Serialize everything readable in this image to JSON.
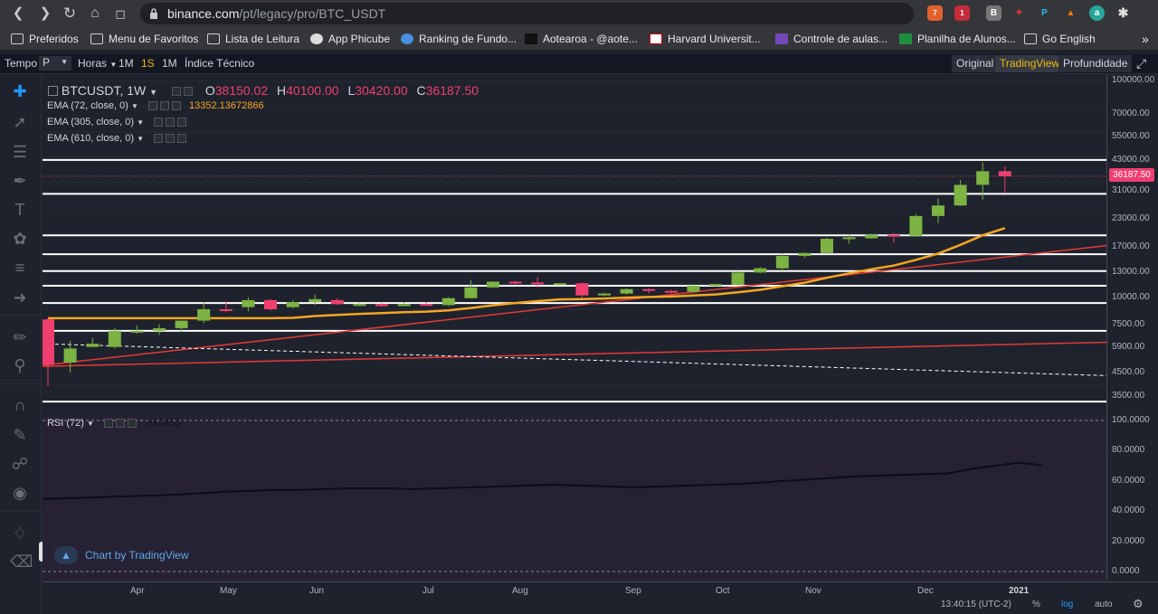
{
  "browser": {
    "url_domain": "binance.com",
    "url_path": "/pt/legacy/pro/BTC_USDT",
    "ext_badge_1": "7",
    "ext_badge_2": "1",
    "bookmarks": [
      {
        "label": "Preferidos",
        "icon": "folder-icon"
      },
      {
        "label": "Menu de Favoritos",
        "icon": "folder-icon"
      },
      {
        "label": "Lista de Leitura",
        "icon": "folder-icon"
      },
      {
        "label": "App Phicube",
        "icon": "globe-icon"
      },
      {
        "label": "Ranking de Fundo...",
        "icon": "page-icon"
      },
      {
        "label": "Aotearoa - @aote...",
        "icon": "page-icon"
      },
      {
        "label": "Harvard Universit...",
        "icon": "page-icon"
      },
      {
        "label": "Controle de aulas...",
        "icon": "form-icon"
      },
      {
        "label": "Planilha de Alunos...",
        "icon": "sheet-icon"
      },
      {
        "label": "Go English",
        "icon": "folder-icon"
      }
    ]
  },
  "toolbar": {
    "tempo": "Tempo",
    "interval": "P",
    "horas": "Horas",
    "m1a": "1M",
    "s1": "1S",
    "m1b": "1M",
    "indicator": "Índice Técnico",
    "view_original": "Original",
    "view_tradingview": "TradingView",
    "view_depth": "Profundidade"
  },
  "legend": {
    "symbol": "BTCUSDT, 1W",
    "o_label": "O",
    "o_value": "38150.02",
    "h_label": "H",
    "h_value": "40100.00",
    "l_label": "L",
    "l_value": "30420.00",
    "c_label": "C",
    "c_value": "36187.50",
    "ema1": "EMA (72, close, 0)",
    "ema1_value": "13352.13672866",
    "ema2": "EMA (305, close, 0)",
    "ema3": "EMA (610, close, 0)",
    "rsi": "RSI (72)",
    "rsi_value": "70.2451",
    "watermark": "Chart by TradingView"
  },
  "price_axis": [
    "100000.00",
    "70000.00",
    "55000.00",
    "43000.00",
    "31000.00",
    "23000.00",
    "17000.00",
    "13000.00",
    "10000.00",
    "7500.00",
    "5900.00",
    "4500.00",
    "3500.00"
  ],
  "last_price": "36187.50",
  "rsi_axis": [
    "100.0000",
    "80.0000",
    "60.0000",
    "40.0000",
    "20.0000",
    "0.0000"
  ],
  "time_axis": [
    "Apr",
    "May",
    "Jun",
    "Jul",
    "Aug",
    "Sep",
    "Oct",
    "Nov",
    "Dec",
    "2021"
  ],
  "status": {
    "clock": "13:40:15 (UTC-2)",
    "percent": "%",
    "log": "log",
    "auto": "auto"
  },
  "colors": {
    "up": "#7cb342",
    "down": "#ef3f6f",
    "ema_short": "#f5a623",
    "line_red": "#e53935",
    "accent": "#f0b90b"
  },
  "chart_data": {
    "type": "candlestick",
    "scale": "log",
    "candles": [
      {
        "o": 7900,
        "h": 8000,
        "c": 4900,
        "l": 3900
      },
      {
        "o": 5000,
        "h": 6300,
        "c": 5800,
        "l": 4500
      },
      {
        "o": 5900,
        "h": 6500,
        "c": 6100,
        "l": 5900
      },
      {
        "o": 5900,
        "h": 7200,
        "c": 7000,
        "l": 5800
      },
      {
        "o": 7000,
        "h": 7400,
        "c": 7000,
        "l": 6800
      },
      {
        "o": 7000,
        "h": 7500,
        "c": 7200,
        "l": 6700
      },
      {
        "o": 7200,
        "h": 7500,
        "c": 7800,
        "l": 6900
      },
      {
        "o": 7800,
        "h": 9500,
        "c": 8800,
        "l": 7600
      },
      {
        "o": 8800,
        "h": 9600,
        "c": 8700,
        "l": 8500
      },
      {
        "o": 9000,
        "h": 10000,
        "c": 9700,
        "l": 8600
      },
      {
        "o": 9700,
        "h": 9800,
        "c": 8800,
        "l": 8700
      },
      {
        "o": 9000,
        "h": 9700,
        "c": 9500,
        "l": 8900
      },
      {
        "o": 9500,
        "h": 10300,
        "c": 9800,
        "l": 9200
      },
      {
        "o": 9700,
        "h": 9900,
        "c": 9300,
        "l": 9200
      },
      {
        "o": 9300,
        "h": 9400,
        "c": 9300,
        "l": 9100
      },
      {
        "o": 9300,
        "h": 9400,
        "c": 9100,
        "l": 9000
      },
      {
        "o": 9100,
        "h": 9500,
        "c": 9300,
        "l": 9100
      },
      {
        "o": 9300,
        "h": 9500,
        "c": 9200,
        "l": 9200
      },
      {
        "o": 9200,
        "h": 10000,
        "c": 9900,
        "l": 9100
      },
      {
        "o": 9900,
        "h": 12000,
        "c": 11100,
        "l": 9900
      },
      {
        "o": 11100,
        "h": 11800,
        "c": 11800,
        "l": 11000
      },
      {
        "o": 11800,
        "h": 11900,
        "c": 11700,
        "l": 11400
      },
      {
        "o": 11700,
        "h": 12400,
        "c": 11500,
        "l": 11100
      },
      {
        "o": 11500,
        "h": 11600,
        "c": 11600,
        "l": 11300
      },
      {
        "o": 11600,
        "h": 11700,
        "c": 10200,
        "l": 10000
      },
      {
        "o": 10200,
        "h": 10500,
        "c": 10400,
        "l": 10100
      },
      {
        "o": 10400,
        "h": 11000,
        "c": 10900,
        "l": 10300
      },
      {
        "o": 10900,
        "h": 11000,
        "c": 10700,
        "l": 10400
      },
      {
        "o": 10700,
        "h": 10800,
        "c": 10600,
        "l": 10400
      },
      {
        "o": 10600,
        "h": 11500,
        "c": 11300,
        "l": 10500
      },
      {
        "o": 11300,
        "h": 11500,
        "c": 11500,
        "l": 11200
      },
      {
        "o": 11400,
        "h": 13200,
        "c": 13000,
        "l": 11300
      },
      {
        "o": 13000,
        "h": 13800,
        "c": 13600,
        "l": 12900
      },
      {
        "o": 13600,
        "h": 15900,
        "c": 15500,
        "l": 13200
      },
      {
        "o": 15500,
        "h": 16100,
        "c": 16000,
        "l": 15200
      },
      {
        "o": 16000,
        "h": 18800,
        "c": 18600,
        "l": 15800
      },
      {
        "o": 18600,
        "h": 19400,
        "c": 18900,
        "l": 17700
      },
      {
        "o": 18700,
        "h": 19600,
        "c": 19400,
        "l": 18600
      },
      {
        "o": 19400,
        "h": 19800,
        "c": 19200,
        "l": 17900
      },
      {
        "o": 19200,
        "h": 24200,
        "c": 23700,
        "l": 19000
      },
      {
        "o": 23700,
        "h": 28600,
        "c": 26500,
        "l": 22000
      },
      {
        "o": 26500,
        "h": 34800,
        "c": 33000,
        "l": 26400
      },
      {
        "o": 33000,
        "h": 41900,
        "c": 38150,
        "l": 28200
      },
      {
        "o": 38150,
        "h": 40100,
        "c": 36187.5,
        "l": 30420
      }
    ],
    "horizontal_levels": [
      43000,
      30000,
      19300,
      15800,
      13200,
      11300,
      9400,
      7000,
      3300
    ],
    "last_price_level": 36187.5,
    "ema_72_end": 13352.13672866,
    "rsi": [
      48,
      48.5,
      49,
      49.5,
      50,
      50.5,
      51,
      52,
      53,
      53.5,
      54,
      54,
      54.5,
      55,
      55,
      55,
      54.5,
      55,
      55.5,
      56,
      56.5,
      57,
      57.5,
      57,
      56.5,
      56,
      56,
      56.5,
      57,
      57.5,
      58,
      59,
      60,
      61,
      62,
      63,
      63.5,
      64,
      64.5,
      65,
      68,
      70,
      72,
      70.5
    ],
    "rsi_range": [
      0,
      100
    ]
  }
}
